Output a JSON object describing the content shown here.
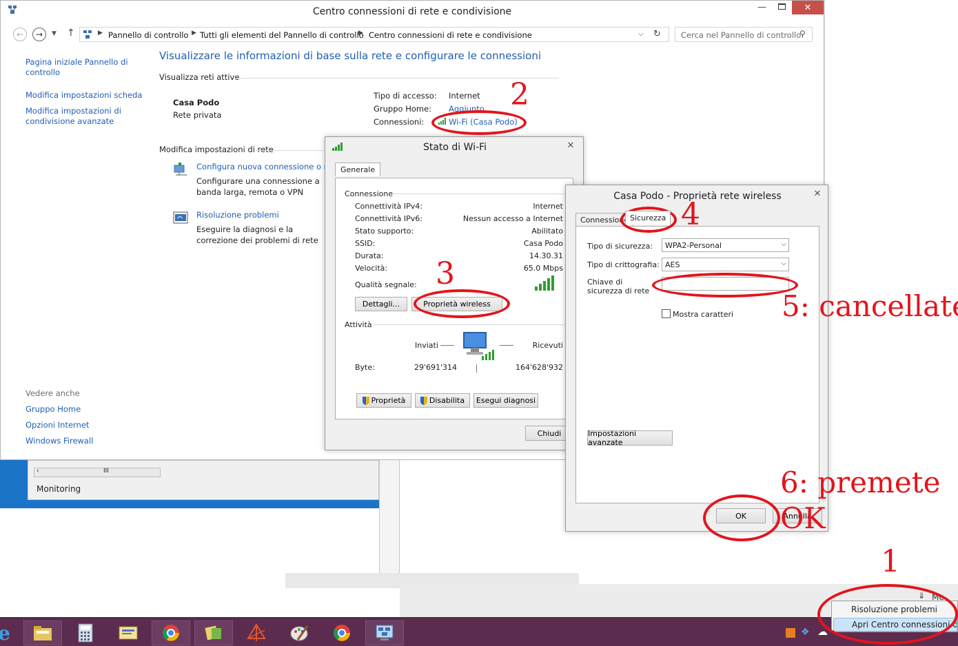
{
  "main_window": {
    "title": "Centro connessioni di rete e condivisione",
    "breadcrumb": [
      "Pannello di controllo",
      "Tutti gli elementi del Pannello di controllo",
      "Centro connessioni di rete e condivisione"
    ],
    "search_placeholder": "Cerca nel Pannello di controllo",
    "sidebar": {
      "home": "Pagina iniziale Pannello di controllo",
      "adapter": "Modifica impostazioni scheda",
      "sharing": "Modifica impostazioni di condivisione avanzate",
      "see_also": "Vedere anche",
      "links": [
        "Gruppo Home",
        "Opzioni Internet",
        "Windows Firewall"
      ]
    },
    "heading": "Visualizzare le informazioni di base sulla rete e configurare le connessioni",
    "active_networks": "Visualizza reti attive",
    "network_name": "Casa Podo",
    "network_type": "Rete privata",
    "access_type_label": "Tipo di accesso:",
    "access_type_value": "Internet",
    "homegroup_label": "Gruppo Home:",
    "homegroup_value": "Aggiunto",
    "connections_label": "Connessioni:",
    "connections_value": "Wi-Fi (Casa Podo)",
    "change_settings": "Modifica impostazioni di rete",
    "setup_link": "Configura nuova connessione o rete",
    "setup_desc": "Configurare una connessione a banda larga, remota o VPN oppure configurare un router o un punto di accesso.",
    "trouble_link": "Risoluzione problemi",
    "trouble_desc": "Eseguire la diagnosi e la correzione dei problemi di rete oppure ottenere informazioni sulla risoluzione dei problemi."
  },
  "background": {
    "monitoring": "Monitoring",
    "scroll_grip": "III"
  },
  "wifi_status": {
    "title": "Stato di Wi-Fi",
    "tab": "Generale",
    "connection_header": "Connessione",
    "rows": [
      {
        "label": "Connettività IPv4:",
        "value": "Internet"
      },
      {
        "label": "Connettività IPv6:",
        "value": "Nessun accesso a Internet"
      },
      {
        "label": "Stato supporto:",
        "value": "Abilitato"
      },
      {
        "label": "SSID:",
        "value": "Casa Podo"
      },
      {
        "label": "Durata:",
        "value": "14.30.31"
      },
      {
        "label": "Velocità:",
        "value": "65.0 Mbps"
      }
    ],
    "signal_label": "Qualità segnale:",
    "details_btn": "Dettagli...",
    "wireless_btn": "Proprietà wireless",
    "activity_header": "Attività",
    "sent_label": "Inviati",
    "received_label": "Ricevuti",
    "bytes_label": "Byte:",
    "bytes_sent": "29'691'314",
    "bytes_received": "164'628'932",
    "properties_btn": "Proprietà",
    "disable_btn": "Disabilita",
    "diagnose_btn": "Esegui diagnosi",
    "close_btn": "Chiudi"
  },
  "wireless_props": {
    "title": "Casa Podo - Proprietà rete wireless",
    "tab_connection": "Connessione",
    "tab_security": "Sicurezza",
    "security_type_label": "Tipo di sicurezza:",
    "security_type_value": "WPA2-Personal",
    "encryption_label": "Tipo di crittografia:",
    "encryption_value": "AES",
    "key_label": "Chiave di sicurezza di rete",
    "key_value": "",
    "show_chars": "Mostra caratteri",
    "advanced_btn": "Impostazioni avanzate",
    "ok_btn": "OK",
    "cancel_btn": "Annulla"
  },
  "annotations": {
    "n1": "1",
    "n2": "2",
    "n3": "3",
    "n4": "4",
    "n5": "5: cancellate",
    "n6a": "6: premete",
    "n6b": "OK"
  },
  "tray_menu": {
    "items": [
      "Risoluzione problemi",
      "Apri Centro connessioni di rete"
    ],
    "hint": "Me"
  },
  "colors": {
    "accent_blue": "#1e5eb4",
    "annotation_red": "#e3141c",
    "taskbar": "#5c2c4e"
  }
}
